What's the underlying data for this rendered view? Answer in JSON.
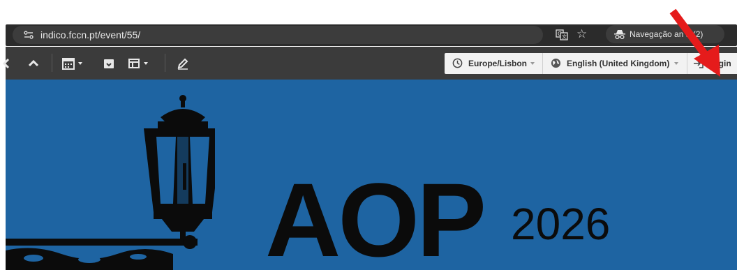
{
  "browser": {
    "url": "indico.fccn.pt/event/55/",
    "incognito_label": "Navegação an     a (2)",
    "icons": [
      "site-info-icon",
      "translate-icon",
      "star-icon",
      "incognito-icon"
    ]
  },
  "toolbar": {
    "left_icons": [
      "back-icon",
      "chevron-up-icon",
      "calendar-icon",
      "archive-icon",
      "layout-icon",
      "edit-pencil-icon"
    ],
    "timezone_label": "Europe/Lisbon",
    "language_label": "English (United Kingdom)",
    "login_label": "Login"
  },
  "banner": {
    "title": "AOP",
    "year": "2026",
    "colors": {
      "background": "#1e64a2",
      "text": "#0b0b0b"
    }
  },
  "annotation": {
    "type": "arrow",
    "color": "#e51b1b",
    "points_to": "login-button"
  }
}
